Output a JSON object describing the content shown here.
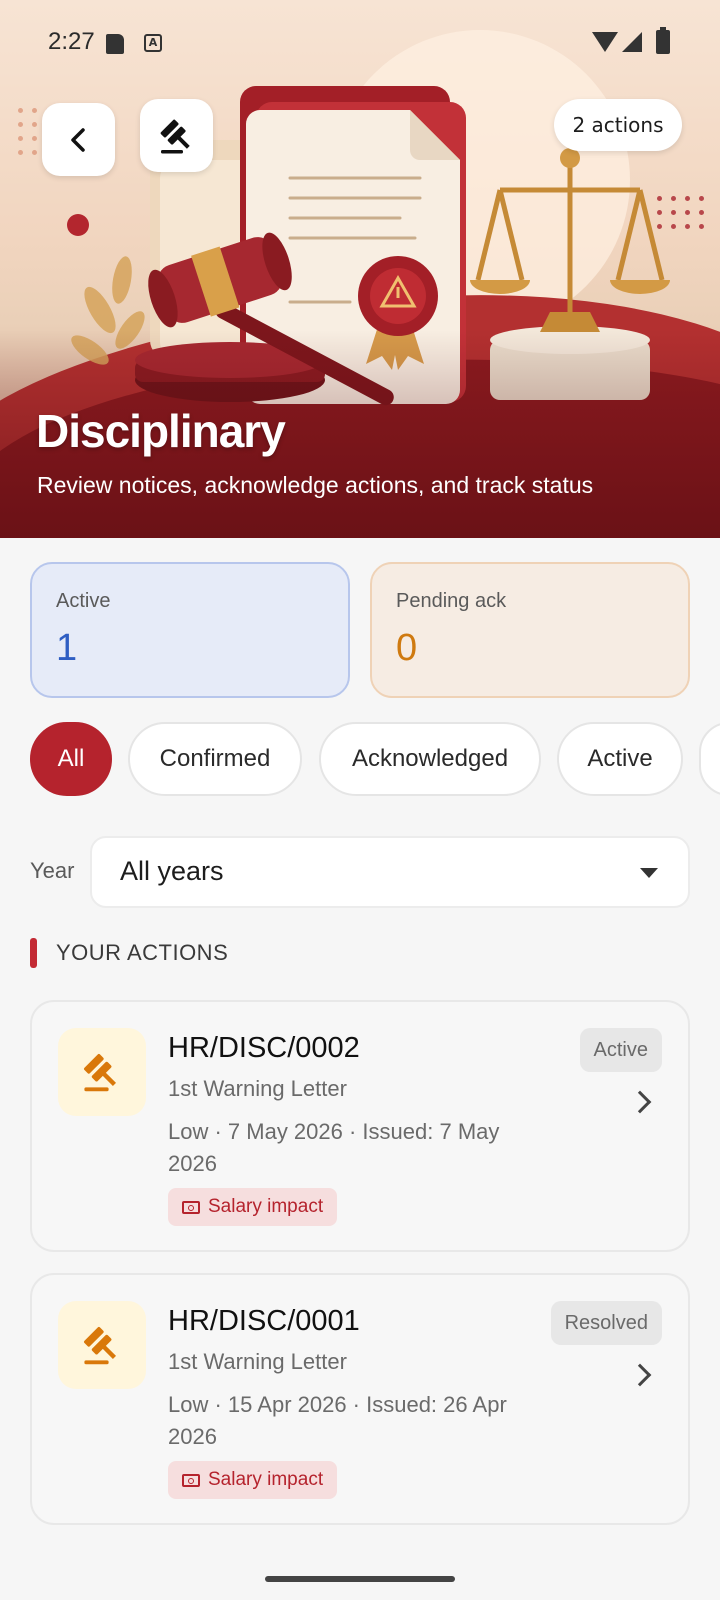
{
  "status_bar": {
    "time": "2:27"
  },
  "header": {
    "actions_count_label": "2 actions",
    "title": "Disciplinary",
    "subtitle": "Review notices, acknowledge actions, and track status"
  },
  "stats": [
    {
      "label": "Active",
      "value": "1",
      "color": "#2f5ec3"
    },
    {
      "label": "Pending ack",
      "value": "0",
      "color": "#cf7a10"
    }
  ],
  "filters": {
    "chips": [
      {
        "label": "All",
        "selected": true
      },
      {
        "label": "Confirmed",
        "selected": false
      },
      {
        "label": "Acknowledged",
        "selected": false
      },
      {
        "label": "Active",
        "selected": false
      }
    ]
  },
  "year_filter": {
    "label": "Year",
    "value": "All years"
  },
  "section": {
    "title": "YOUR ACTIONS"
  },
  "actions": [
    {
      "id": "HR/DISC/0002",
      "type": "1st Warning Letter",
      "meta": "Low · 7 May 2026 · Issued: 7 May 2026",
      "status": "Active",
      "tag": "Salary impact"
    },
    {
      "id": "HR/DISC/0001",
      "type": "1st Warning Letter",
      "meta": "Low · 15 Apr 2026 · Issued: 26 Apr 2026",
      "status": "Resolved",
      "tag": "Salary impact"
    }
  ],
  "colors": {
    "accent": "#b5232d",
    "icon_gavel": "#d9780a",
    "hero_red": "#8b1a1f"
  }
}
